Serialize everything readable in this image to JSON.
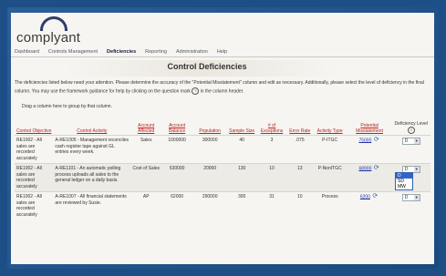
{
  "app": {
    "logo_text": "complyant"
  },
  "nav": {
    "items": [
      "Dashboard",
      "Controls Management",
      "Deficiencies",
      "Reporting",
      "Administration",
      "Help"
    ],
    "active_index": 2
  },
  "page_title": "Control Deficiencies",
  "intro": "The deficiencies listed below need your attention. Please determine the accuracy of the \"Potential Misstatement\" column and edit as necessary. Additionally, please select the level of deficiency in the final column. You may use the framework guidance for help by clicking on the question mark",
  "intro_tail": "in the column header.",
  "help_icon": "?",
  "group_hint": "Drag a column here to group by that column.",
  "columns": [
    "Control Objective",
    "Control Activity",
    "Account Affected",
    "Account Balance",
    "Population",
    "Sample Size",
    "# of Exceptions",
    "Error Rate",
    "Activity Type",
    "Potential Misstatement",
    "Deficiency Level"
  ],
  "rows": [
    {
      "objective": "RE1002 - All sales are recorded accurately",
      "activity": "A-RE1005 - Management reconciles cash register tape against GL entries every week.",
      "account": "Sales",
      "balance": "1000000",
      "population": "300000",
      "sample": "40",
      "exceptions": "3",
      "error_rate": ".075",
      "type": "P-ITGC",
      "misstatement": "75000",
      "level": "D"
    },
    {
      "objective": "RE1002 - All sales are recorded accurately",
      "activity": "A-RE1101 - An automatic polling process uploads all sales to the general ledger on a daily basis.",
      "account": "Cost of Sales",
      "balance": "530000",
      "population": "20000",
      "sample": "130",
      "exceptions": "10",
      "error_rate": "13",
      "type": "P-NonITGC",
      "misstatement": "68900",
      "level": "D"
    },
    {
      "objective": "RE1002 - All sales are recorded accurately",
      "activity": "A-RE1007 - All financial statements are reviewed by Susie.",
      "account": "AP",
      "balance": "62000",
      "population": "290000",
      "sample": "300",
      "exceptions": "31",
      "error_rate": "10",
      "type": "Process",
      "misstatement": "6200",
      "level": "D"
    }
  ],
  "level_options": [
    "D",
    "SD",
    "MW"
  ],
  "colors": {
    "header_link": "#b22222",
    "link": "#2435a8",
    "accent": "#3264c8"
  }
}
